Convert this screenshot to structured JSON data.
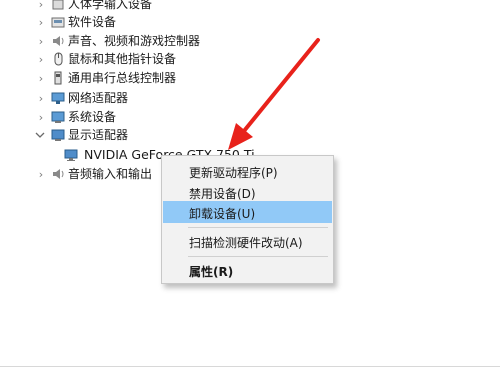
{
  "tree": {
    "items": [
      {
        "label": "人体学输入设备",
        "expanded": false
      },
      {
        "label": "软件设备",
        "expanded": false
      },
      {
        "label": "声音、视频和游戏控制器",
        "expanded": false
      },
      {
        "label": "鼠标和其他指针设备",
        "expanded": false
      },
      {
        "label": "通用串行总线控制器",
        "expanded": false
      },
      {
        "label": "网络适配器",
        "expanded": false
      },
      {
        "label": "系统设备",
        "expanded": false
      },
      {
        "label": "显示适配器",
        "expanded": true
      },
      {
        "label": "音频输入和输出",
        "expanded": false
      }
    ],
    "selected_device": "NVIDIA GeForce GTX 750 Ti"
  },
  "context_menu": {
    "items": [
      {
        "label": "更新驱动程序(P)"
      },
      {
        "label": "禁用设备(D)"
      },
      {
        "label": "卸载设备(U)",
        "highlighted": true
      },
      {
        "label": "扫描检测硬件改动(A)"
      },
      {
        "label": "属性(R)",
        "bold": true
      }
    ]
  },
  "colors": {
    "highlight": "#91c9f7",
    "arrow": "#e8221b",
    "menu_bg": "#f2f2f2"
  },
  "icons": {
    "collapsed": "chevron-right-icon",
    "expanded": "chevron-down-icon",
    "device": "monitor-icon"
  }
}
